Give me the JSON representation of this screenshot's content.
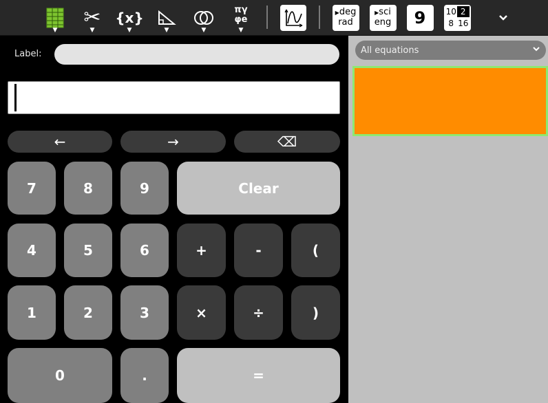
{
  "toolbar": {
    "items": [
      {
        "name": "grid-icon"
      },
      {
        "name": "scissors-icon",
        "glyph": "✂"
      },
      {
        "name": "variable-icon",
        "glyph": "{x}"
      },
      {
        "name": "trigonometry-icon"
      },
      {
        "name": "boolean-icon"
      },
      {
        "name": "constants-icon",
        "glyph_top": "πγ",
        "glyph_bottom": "φe"
      }
    ],
    "plot_icon": "plot-icon",
    "angle_toggle": {
      "top": "deg",
      "bottom": "rad"
    },
    "notation_toggle": {
      "top": "sci",
      "bottom": "eng"
    },
    "digits_label": "9",
    "base_toggle": {
      "a": "10",
      "b": "2",
      "c": "8",
      "d": "16"
    },
    "more_icon": "chevron-down-icon"
  },
  "editor": {
    "label_text": "Label:",
    "label_value": "",
    "expression_value": ""
  },
  "nav": {
    "left": "←",
    "right": "→",
    "backspace": "⌫"
  },
  "keypad": {
    "k7": "7",
    "k8": "8",
    "k9": "9",
    "clear": "Clear",
    "k4": "4",
    "k5": "5",
    "k6": "6",
    "plus": "+",
    "minus": "-",
    "lparen": "(",
    "k1": "1",
    "k2": "2",
    "k3": "3",
    "times": "×",
    "divide": "÷",
    "rparen": ")",
    "k0": "0",
    "dot": ".",
    "equals": "="
  },
  "equations": {
    "filter_value": "All equations",
    "entry_color": "#ff8c00",
    "entry_border": "#8ee870"
  }
}
